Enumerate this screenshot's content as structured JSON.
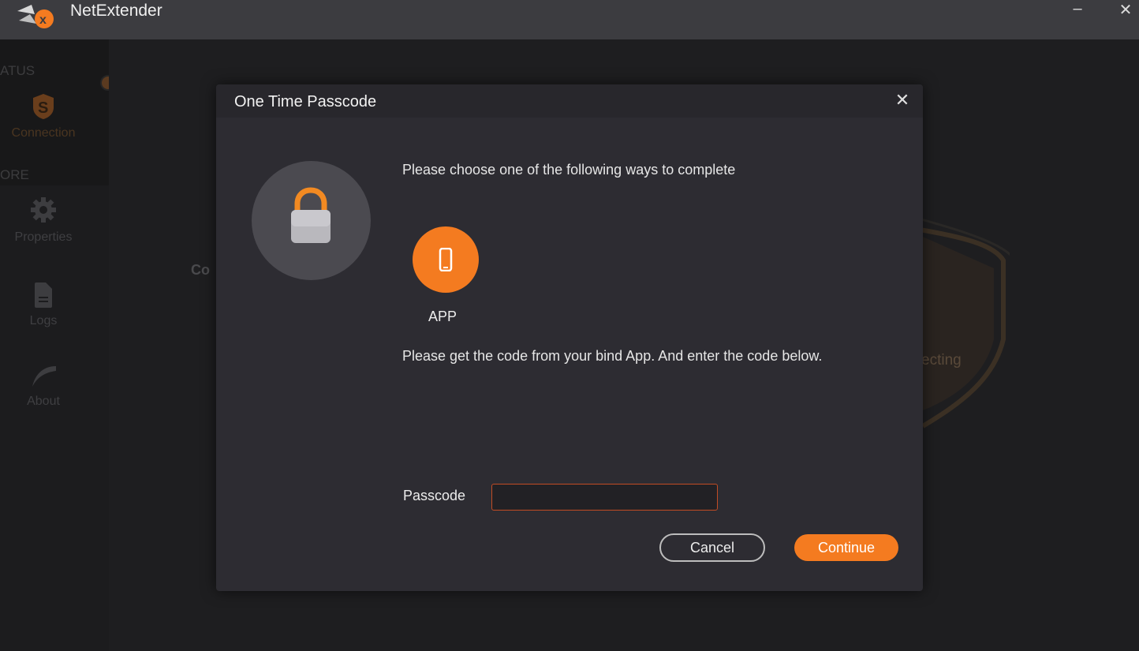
{
  "window": {
    "title": "NetExtender",
    "minimize_glyph": "–",
    "close_glyph": "✕"
  },
  "sidebar": {
    "sections": [
      {
        "label": "ATUS"
      },
      {
        "label": "ORE"
      }
    ],
    "items": [
      {
        "label": "Connection",
        "icon": "sonicwall-s-icon"
      },
      {
        "label": "Properties",
        "icon": "gear-icon"
      },
      {
        "label": "Logs",
        "icon": "document-icon"
      },
      {
        "label": "About",
        "icon": "sonicwall-swoosh-icon"
      }
    ]
  },
  "background": {
    "partial_label": "Co",
    "status_text": "ecting"
  },
  "dialog": {
    "title": "One Time Passcode",
    "close_glyph": "✕",
    "instruction": "Please choose one of the following ways to complete",
    "method_label": "APP",
    "description": "Please get the code from your bind App. And enter the code below.",
    "passcode_label": "Passcode",
    "passcode_value": "",
    "cancel_label": "Cancel",
    "continue_label": "Continue"
  },
  "colors": {
    "accent": "#f47b20",
    "dialog_bg": "#2d2c32",
    "titlebar_bg": "#3c3c40"
  }
}
